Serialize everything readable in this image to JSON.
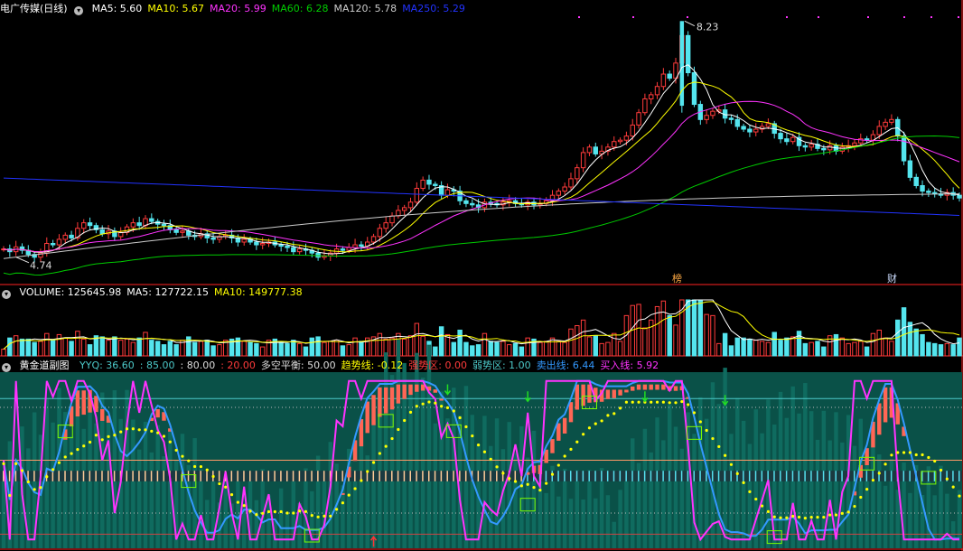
{
  "colors": {
    "up": "#ff3b3b",
    "down": "#54e5ee",
    "ma5": "#ffffff",
    "ma10": "#ffff00",
    "ma20": "#ff33ff",
    "ma60": "#00cc00",
    "ma120": "#cccccc",
    "ma250": "#2233ff",
    "vol_ma5": "#ffffff",
    "vol_ma10": "#ffff00",
    "teal": "#0a5148",
    "teal_bar": "#0f6b5f",
    "cyan_line": "#3399ff",
    "magenta": "#ff33ff",
    "yellow_dots": "#ffff00",
    "salmon": "#ff6655",
    "hline": "#4cc9c9",
    "green_box": "#7cfc00"
  },
  "price_panel": {
    "title": "电广传媒(日线)",
    "legend": [
      {
        "label": "MA5: 5.60",
        "color": "#ffffff"
      },
      {
        "label": "MA10: 5.67",
        "color": "#ffff00"
      },
      {
        "label": "MA20: 5.99",
        "color": "#ff33ff"
      },
      {
        "label": "MA60: 6.28",
        "color": "#00cc00"
      },
      {
        "label": "MA120: 5.78",
        "color": "#cccccc"
      },
      {
        "label": "MA250: 5.29",
        "color": "#2233ff"
      }
    ],
    "high_label": "8.23",
    "low_label": "4.74",
    "tags": [
      {
        "text": "榜",
        "color": "#ffaa44"
      },
      {
        "text": "财",
        "color": "#ccddff"
      }
    ]
  },
  "volume_panel": {
    "legend": [
      {
        "label": "VOLUME: 125645.98",
        "color": "#ffffff"
      },
      {
        "label": "MA5: 127722.15",
        "color": "#ffffff"
      },
      {
        "label": "MA10: 149777.38",
        "color": "#ffff00"
      }
    ]
  },
  "indicator_panel": {
    "title": "黄金道副图",
    "legend": [
      {
        "label": "YYQ: 36.60",
        "color": "#4cc9c9"
      },
      {
        "label": ": 85.00",
        "color": "#4cc9c9"
      },
      {
        "label": ": 80.00",
        "color": "#dddddd"
      },
      {
        "label": ": 20.00",
        "color": "#ff3b3b"
      },
      {
        "label": "多空平衡: 50.00",
        "color": "#dddddd"
      },
      {
        "label": "趋势线: -0.12",
        "color": "#ffff00"
      },
      {
        "label": "强势区: 0.00",
        "color": "#ff3b3b"
      },
      {
        "label": "弱势区: 1.00",
        "color": "#4cc9c9"
      },
      {
        "label": "卖出线: 6.44",
        "color": "#3399ff"
      },
      {
        "label": "买入线: 5.92",
        "color": "#ff33ff"
      }
    ]
  },
  "chart_data": {
    "type": "candlestick",
    "price_axis": {
      "min": 4.74,
      "max": 8.23
    },
    "annotations": [
      "8.23",
      "4.74"
    ],
    "price_series": [
      {
        "name": "MA5",
        "value": 5.6
      },
      {
        "name": "MA10",
        "value": 5.67
      },
      {
        "name": "MA20",
        "value": 5.99
      },
      {
        "name": "MA60",
        "value": 6.28
      },
      {
        "name": "MA120",
        "value": 5.78
      },
      {
        "name": "MA250",
        "value": 5.29
      }
    ],
    "volume_series": [
      {
        "name": "VOLUME",
        "value": 125645.98
      },
      {
        "name": "MA5",
        "value": 127722.15
      },
      {
        "name": "MA10",
        "value": 149777.38
      }
    ],
    "indicator_series": [
      {
        "name": "YYQ",
        "value": 36.6
      },
      {
        "name": "",
        "value": 85.0
      },
      {
        "name": "",
        "value": 80.0
      },
      {
        "name": "",
        "value": 20.0
      },
      {
        "name": "多空平衡",
        "value": 50.0
      },
      {
        "name": "趋势线",
        "value": -0.12
      },
      {
        "name": "强势区",
        "value": 0.0
      },
      {
        "name": "弱势区",
        "value": 1.0
      },
      {
        "name": "卖出线",
        "value": 6.44
      },
      {
        "name": "买入线",
        "value": 5.92
      }
    ],
    "candles_close": [
      4.92,
      4.88,
      4.95,
      4.9,
      4.84,
      4.8,
      4.86,
      5.0,
      4.98,
      5.06,
      5.12,
      5.08,
      5.22,
      5.3,
      5.26,
      5.2,
      5.14,
      5.18,
      5.1,
      5.16,
      5.24,
      5.3,
      5.26,
      5.36,
      5.32,
      5.28,
      5.26,
      5.2,
      5.16,
      5.18,
      5.12,
      5.1,
      5.14,
      5.08,
      5.06,
      5.1,
      5.12,
      5.08,
      5.02,
      5.06,
      5.02,
      4.98,
      5.0,
      5.02,
      4.98,
      4.96,
      4.94,
      4.88,
      4.92,
      4.9,
      4.86,
      4.8,
      4.82,
      4.86,
      4.92,
      4.9,
      4.94,
      4.98,
      4.96,
      5.02,
      5.1,
      5.22,
      5.3,
      5.4,
      5.48,
      5.52,
      5.6,
      5.8,
      5.92,
      5.86,
      5.84,
      5.7,
      5.78,
      5.76,
      5.62,
      5.58,
      5.56,
      5.52,
      5.6,
      5.58,
      5.56,
      5.6,
      5.62,
      5.58,
      5.56,
      5.6,
      5.56,
      5.58,
      5.62,
      5.7,
      5.76,
      5.82,
      5.94,
      6.1,
      6.32,
      6.4,
      6.3,
      6.34,
      6.4,
      6.48,
      6.5,
      6.56,
      6.72,
      6.9,
      7.1,
      7.16,
      7.28,
      7.46,
      7.4,
      7.62,
      8.02,
      7.48,
      7.02,
      6.8,
      6.86,
      6.92,
      6.94,
      6.82,
      6.8,
      6.7,
      6.66,
      6.62,
      6.66,
      6.7,
      6.74,
      6.6,
      6.52,
      6.48,
      6.54,
      6.42,
      6.4,
      6.44,
      6.38,
      6.36,
      6.42,
      6.34,
      6.4,
      6.42,
      6.46,
      6.52,
      6.5,
      6.58,
      6.7,
      6.76,
      6.8,
      6.56,
      6.2,
      5.96,
      5.84,
      5.76,
      5.74,
      5.72,
      5.7,
      5.74,
      5.7,
      5.66
    ]
  }
}
